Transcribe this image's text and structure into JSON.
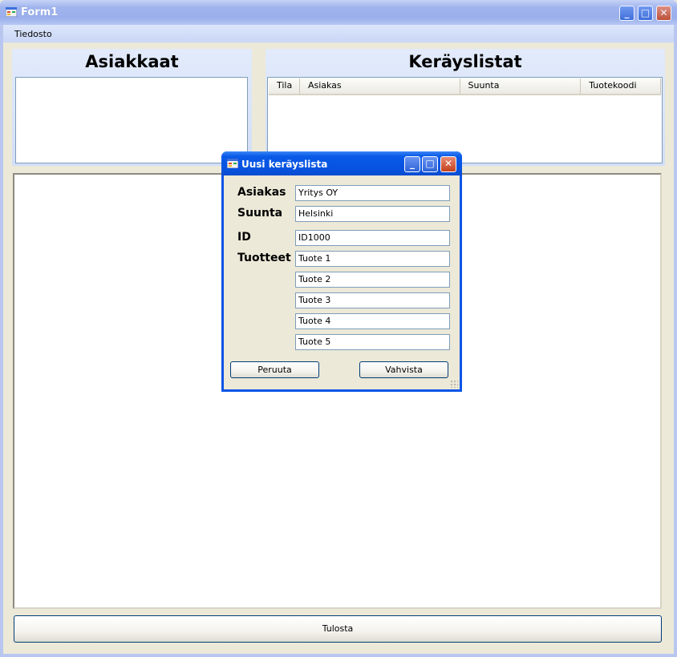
{
  "window": {
    "title": "Form1",
    "min_glyph": "_",
    "max_glyph": "□",
    "close_glyph": "✕"
  },
  "menu": {
    "items": [
      {
        "label": "Tiedosto"
      }
    ]
  },
  "customers_panel": {
    "title": "Asiakkaat"
  },
  "picklists_panel": {
    "title": "Keräyslistat",
    "columns": [
      "Tila",
      "Asiakas",
      "Suunta",
      "Tuotekoodi"
    ]
  },
  "print_button": {
    "label": "Tulosta"
  },
  "dialog": {
    "title": "Uusi keräyslista",
    "min_glyph": "_",
    "max_glyph": "□",
    "close_glyph": "✕",
    "labels": {
      "customer": "Asiakas",
      "direction": "Suunta",
      "id": "ID",
      "products": "Tuotteet"
    },
    "fields": {
      "customer": "Yritys OY",
      "direction": "Helsinki",
      "id": "ID1000",
      "products": [
        "Tuote 1",
        "Tuote 2",
        "Tuote 3",
        "Tuote 4",
        "Tuote 5"
      ]
    },
    "cancel_label": "Peruuta",
    "confirm_label": "Vahvista"
  },
  "icons": {
    "app": "form-icon"
  }
}
